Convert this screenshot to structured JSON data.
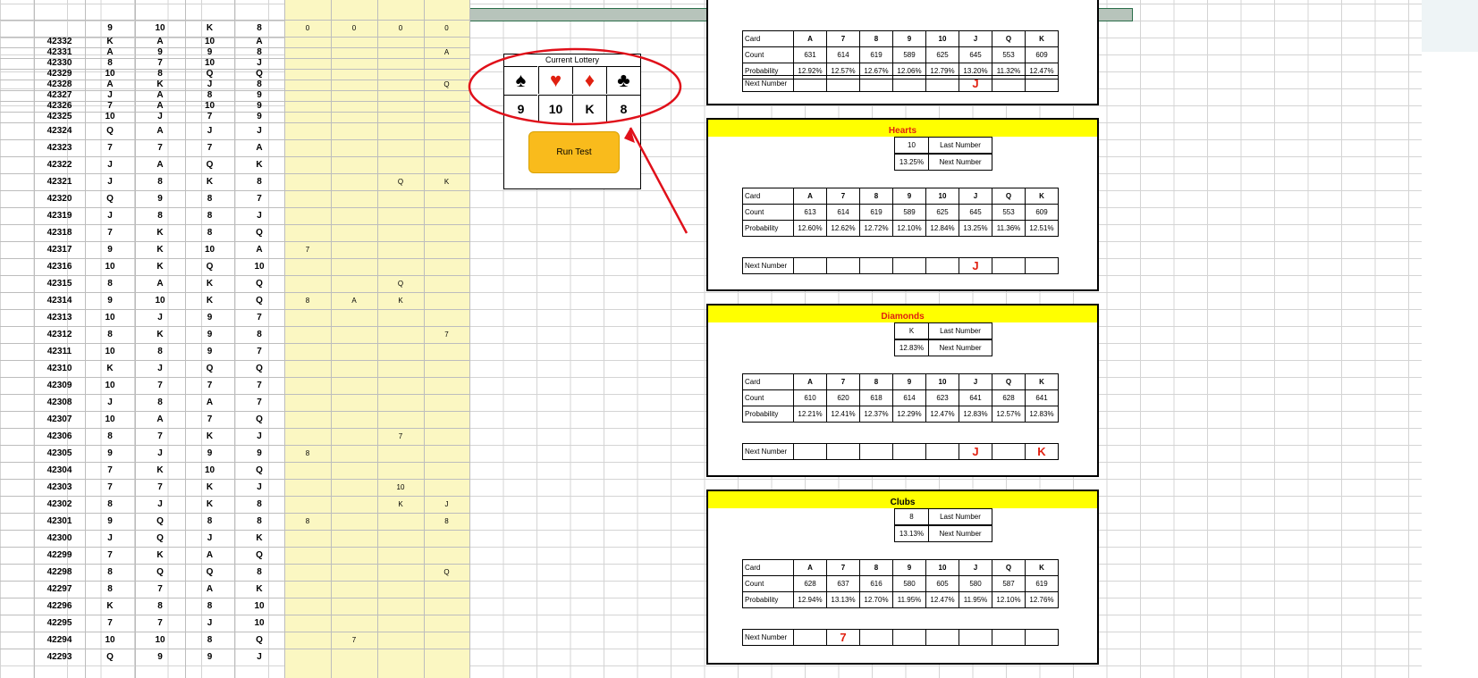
{
  "table_header": [
    "9",
    "10",
    "K",
    "8",
    "0",
    "0",
    "0",
    "0"
  ],
  "rows": [
    {
      "id": "42332",
      "c": [
        "K",
        "A",
        "10",
        "A"
      ],
      "y": [
        "",
        "",
        "",
        ""
      ]
    },
    {
      "id": "42331",
      "c": [
        "A",
        "9",
        "9",
        "8"
      ],
      "y": [
        "",
        "",
        "",
        "A"
      ]
    },
    {
      "id": "42330",
      "c": [
        "8",
        "7",
        "10",
        "J"
      ],
      "y": [
        "",
        "",
        "",
        ""
      ]
    },
    {
      "id": "42329",
      "c": [
        "10",
        "8",
        "Q",
        "Q"
      ],
      "y": [
        "",
        "",
        "",
        ""
      ]
    },
    {
      "id": "42328",
      "c": [
        "A",
        "K",
        "J",
        "8"
      ],
      "y": [
        "",
        "",
        "",
        "Q"
      ]
    },
    {
      "id": "42327",
      "c": [
        "J",
        "A",
        "8",
        "9"
      ],
      "y": [
        "",
        "",
        "",
        ""
      ]
    },
    {
      "id": "42326",
      "c": [
        "7",
        "A",
        "10",
        "9"
      ],
      "y": [
        "",
        "",
        "",
        ""
      ]
    },
    {
      "id": "42325",
      "c": [
        "10",
        "J",
        "7",
        "9"
      ],
      "y": [
        "",
        "",
        "",
        ""
      ]
    },
    {
      "id": "42324",
      "c": [
        "Q",
        "A",
        "J",
        "J"
      ],
      "y": [
        "",
        "",
        "",
        ""
      ]
    },
    {
      "id": "42323",
      "c": [
        "7",
        "7",
        "7",
        "A"
      ],
      "y": [
        "",
        "",
        "",
        ""
      ]
    },
    {
      "id": "42322",
      "c": [
        "J",
        "A",
        "Q",
        "K"
      ],
      "y": [
        "",
        "",
        "",
        ""
      ]
    },
    {
      "id": "42321",
      "c": [
        "J",
        "8",
        "K",
        "8"
      ],
      "y": [
        "",
        "",
        "Q",
        "K"
      ]
    },
    {
      "id": "42320",
      "c": [
        "Q",
        "9",
        "8",
        "7"
      ],
      "y": [
        "",
        "",
        "",
        ""
      ]
    },
    {
      "id": "42319",
      "c": [
        "J",
        "8",
        "8",
        "J"
      ],
      "y": [
        "",
        "",
        "",
        ""
      ]
    },
    {
      "id": "42318",
      "c": [
        "7",
        "K",
        "8",
        "Q"
      ],
      "y": [
        "",
        "",
        "",
        ""
      ]
    },
    {
      "id": "42317",
      "c": [
        "9",
        "K",
        "10",
        "A"
      ],
      "y": [
        "7",
        "",
        "",
        ""
      ]
    },
    {
      "id": "42316",
      "c": [
        "10",
        "K",
        "Q",
        "10"
      ],
      "y": [
        "",
        "",
        "",
        ""
      ]
    },
    {
      "id": "42315",
      "c": [
        "8",
        "A",
        "K",
        "Q"
      ],
      "y": [
        "",
        "",
        "Q",
        ""
      ]
    },
    {
      "id": "42314",
      "c": [
        "9",
        "10",
        "K",
        "Q"
      ],
      "y": [
        "8",
        "A",
        "K",
        ""
      ]
    },
    {
      "id": "42313",
      "c": [
        "10",
        "J",
        "9",
        "7"
      ],
      "y": [
        "",
        "",
        "",
        ""
      ]
    },
    {
      "id": "42312",
      "c": [
        "8",
        "K",
        "9",
        "8"
      ],
      "y": [
        "",
        "",
        "",
        "7"
      ]
    },
    {
      "id": "42311",
      "c": [
        "10",
        "8",
        "9",
        "7"
      ],
      "y": [
        "",
        "",
        "",
        ""
      ]
    },
    {
      "id": "42310",
      "c": [
        "K",
        "J",
        "Q",
        "Q"
      ],
      "y": [
        "",
        "",
        "",
        ""
      ]
    },
    {
      "id": "42309",
      "c": [
        "10",
        "7",
        "7",
        "7"
      ],
      "y": [
        "",
        "",
        "",
        ""
      ]
    },
    {
      "id": "42308",
      "c": [
        "J",
        "8",
        "A",
        "7"
      ],
      "y": [
        "",
        "",
        "",
        ""
      ]
    },
    {
      "id": "42307",
      "c": [
        "10",
        "A",
        "7",
        "Q"
      ],
      "y": [
        "",
        "",
        "",
        ""
      ]
    },
    {
      "id": "42306",
      "c": [
        "8",
        "7",
        "K",
        "J"
      ],
      "y": [
        "",
        "",
        "7",
        ""
      ]
    },
    {
      "id": "42305",
      "c": [
        "9",
        "J",
        "9",
        "9"
      ],
      "y": [
        "8",
        "",
        "",
        ""
      ]
    },
    {
      "id": "42304",
      "c": [
        "7",
        "K",
        "10",
        "Q"
      ],
      "y": [
        "",
        "",
        "",
        ""
      ]
    },
    {
      "id": "42303",
      "c": [
        "7",
        "7",
        "K",
        "J"
      ],
      "y": [
        "",
        "",
        "10",
        ""
      ]
    },
    {
      "id": "42302",
      "c": [
        "8",
        "J",
        "K",
        "8"
      ],
      "y": [
        "",
        "",
        "K",
        "J"
      ]
    },
    {
      "id": "42301",
      "c": [
        "9",
        "Q",
        "8",
        "8"
      ],
      "y": [
        "8",
        "",
        "",
        "8"
      ]
    },
    {
      "id": "42300",
      "c": [
        "J",
        "Q",
        "J",
        "K"
      ],
      "y": [
        "",
        "",
        "",
        ""
      ]
    },
    {
      "id": "42299",
      "c": [
        "7",
        "K",
        "A",
        "Q"
      ],
      "y": [
        "",
        "",
        "",
        ""
      ]
    },
    {
      "id": "42298",
      "c": [
        "8",
        "Q",
        "Q",
        "8"
      ],
      "y": [
        "",
        "",
        "",
        "Q"
      ]
    },
    {
      "id": "42297",
      "c": [
        "8",
        "7",
        "A",
        "K"
      ],
      "y": [
        "",
        "",
        "",
        ""
      ]
    },
    {
      "id": "42296",
      "c": [
        "K",
        "8",
        "8",
        "10"
      ],
      "y": [
        "",
        "",
        "",
        ""
      ]
    },
    {
      "id": "42295",
      "c": [
        "7",
        "7",
        "J",
        "10"
      ],
      "y": [
        "",
        "",
        "",
        ""
      ]
    },
    {
      "id": "42294",
      "c": [
        "10",
        "10",
        "8",
        "Q"
      ],
      "y": [
        "",
        "7",
        "",
        ""
      ]
    },
    {
      "id": "42293",
      "c": [
        "Q",
        "9",
        "9",
        "J"
      ],
      "y": [
        "",
        "",
        "",
        ""
      ]
    }
  ],
  "lottery": {
    "title": "Current Lottery",
    "suits": [
      "♠",
      "♥",
      "♦",
      "♣"
    ],
    "numbers": [
      "9",
      "10",
      "K",
      "8"
    ],
    "run_label": "Run Test"
  },
  "top_strip": {
    "prob": "13.20%",
    "label": "Next Number"
  },
  "card_headers": [
    "A",
    "7",
    "8",
    "9",
    "10",
    "J",
    "Q",
    "K"
  ],
  "labels": {
    "card": "Card",
    "count": "Count",
    "probability": "Probability",
    "next": "Next Number",
    "last": "Last Number",
    "next_number": "Next Number"
  },
  "panels": [
    {
      "name": "",
      "color": "",
      "last": "",
      "prob": "",
      "counts": [
        "631",
        "614",
        "619",
        "589",
        "625",
        "645",
        "553",
        "609"
      ],
      "probs": [
        "12.92%",
        "12.57%",
        "12.67%",
        "12.06%",
        "12.79%",
        "13.20%",
        "11.32%",
        "12.47%"
      ],
      "next": [
        "",
        "",
        "",
        "",
        "",
        "J",
        "",
        ""
      ]
    },
    {
      "name": "Hearts",
      "color": "#e02010",
      "last": "10",
      "prob": "13.25%",
      "counts": [
        "613",
        "614",
        "619",
        "589",
        "625",
        "645",
        "553",
        "609"
      ],
      "probs": [
        "12.60%",
        "12.62%",
        "12.72%",
        "12.10%",
        "12.84%",
        "13.25%",
        "11.36%",
        "12.51%"
      ],
      "next": [
        "",
        "",
        "",
        "",
        "",
        "J",
        "",
        ""
      ]
    },
    {
      "name": "Diamonds",
      "color": "#e02010",
      "last": "K",
      "prob": "12.83%",
      "counts": [
        "610",
        "620",
        "618",
        "614",
        "623",
        "641",
        "628",
        "641"
      ],
      "probs": [
        "12.21%",
        "12.41%",
        "12.37%",
        "12.29%",
        "12.47%",
        "12.83%",
        "12.57%",
        "12.83%"
      ],
      "next": [
        "",
        "",
        "",
        "",
        "",
        "J",
        "",
        "K"
      ]
    },
    {
      "name": "Clubs",
      "color": "#000000",
      "last": "8",
      "prob": "13.13%",
      "counts": [
        "628",
        "637",
        "616",
        "580",
        "605",
        "580",
        "587",
        "619"
      ],
      "probs": [
        "12.94%",
        "13.13%",
        "12.70%",
        "11.95%",
        "12.47%",
        "11.95%",
        "12.10%",
        "12.76%"
      ],
      "next": [
        "",
        "7",
        "",
        "",
        "",
        "",
        "",
        ""
      ]
    }
  ]
}
